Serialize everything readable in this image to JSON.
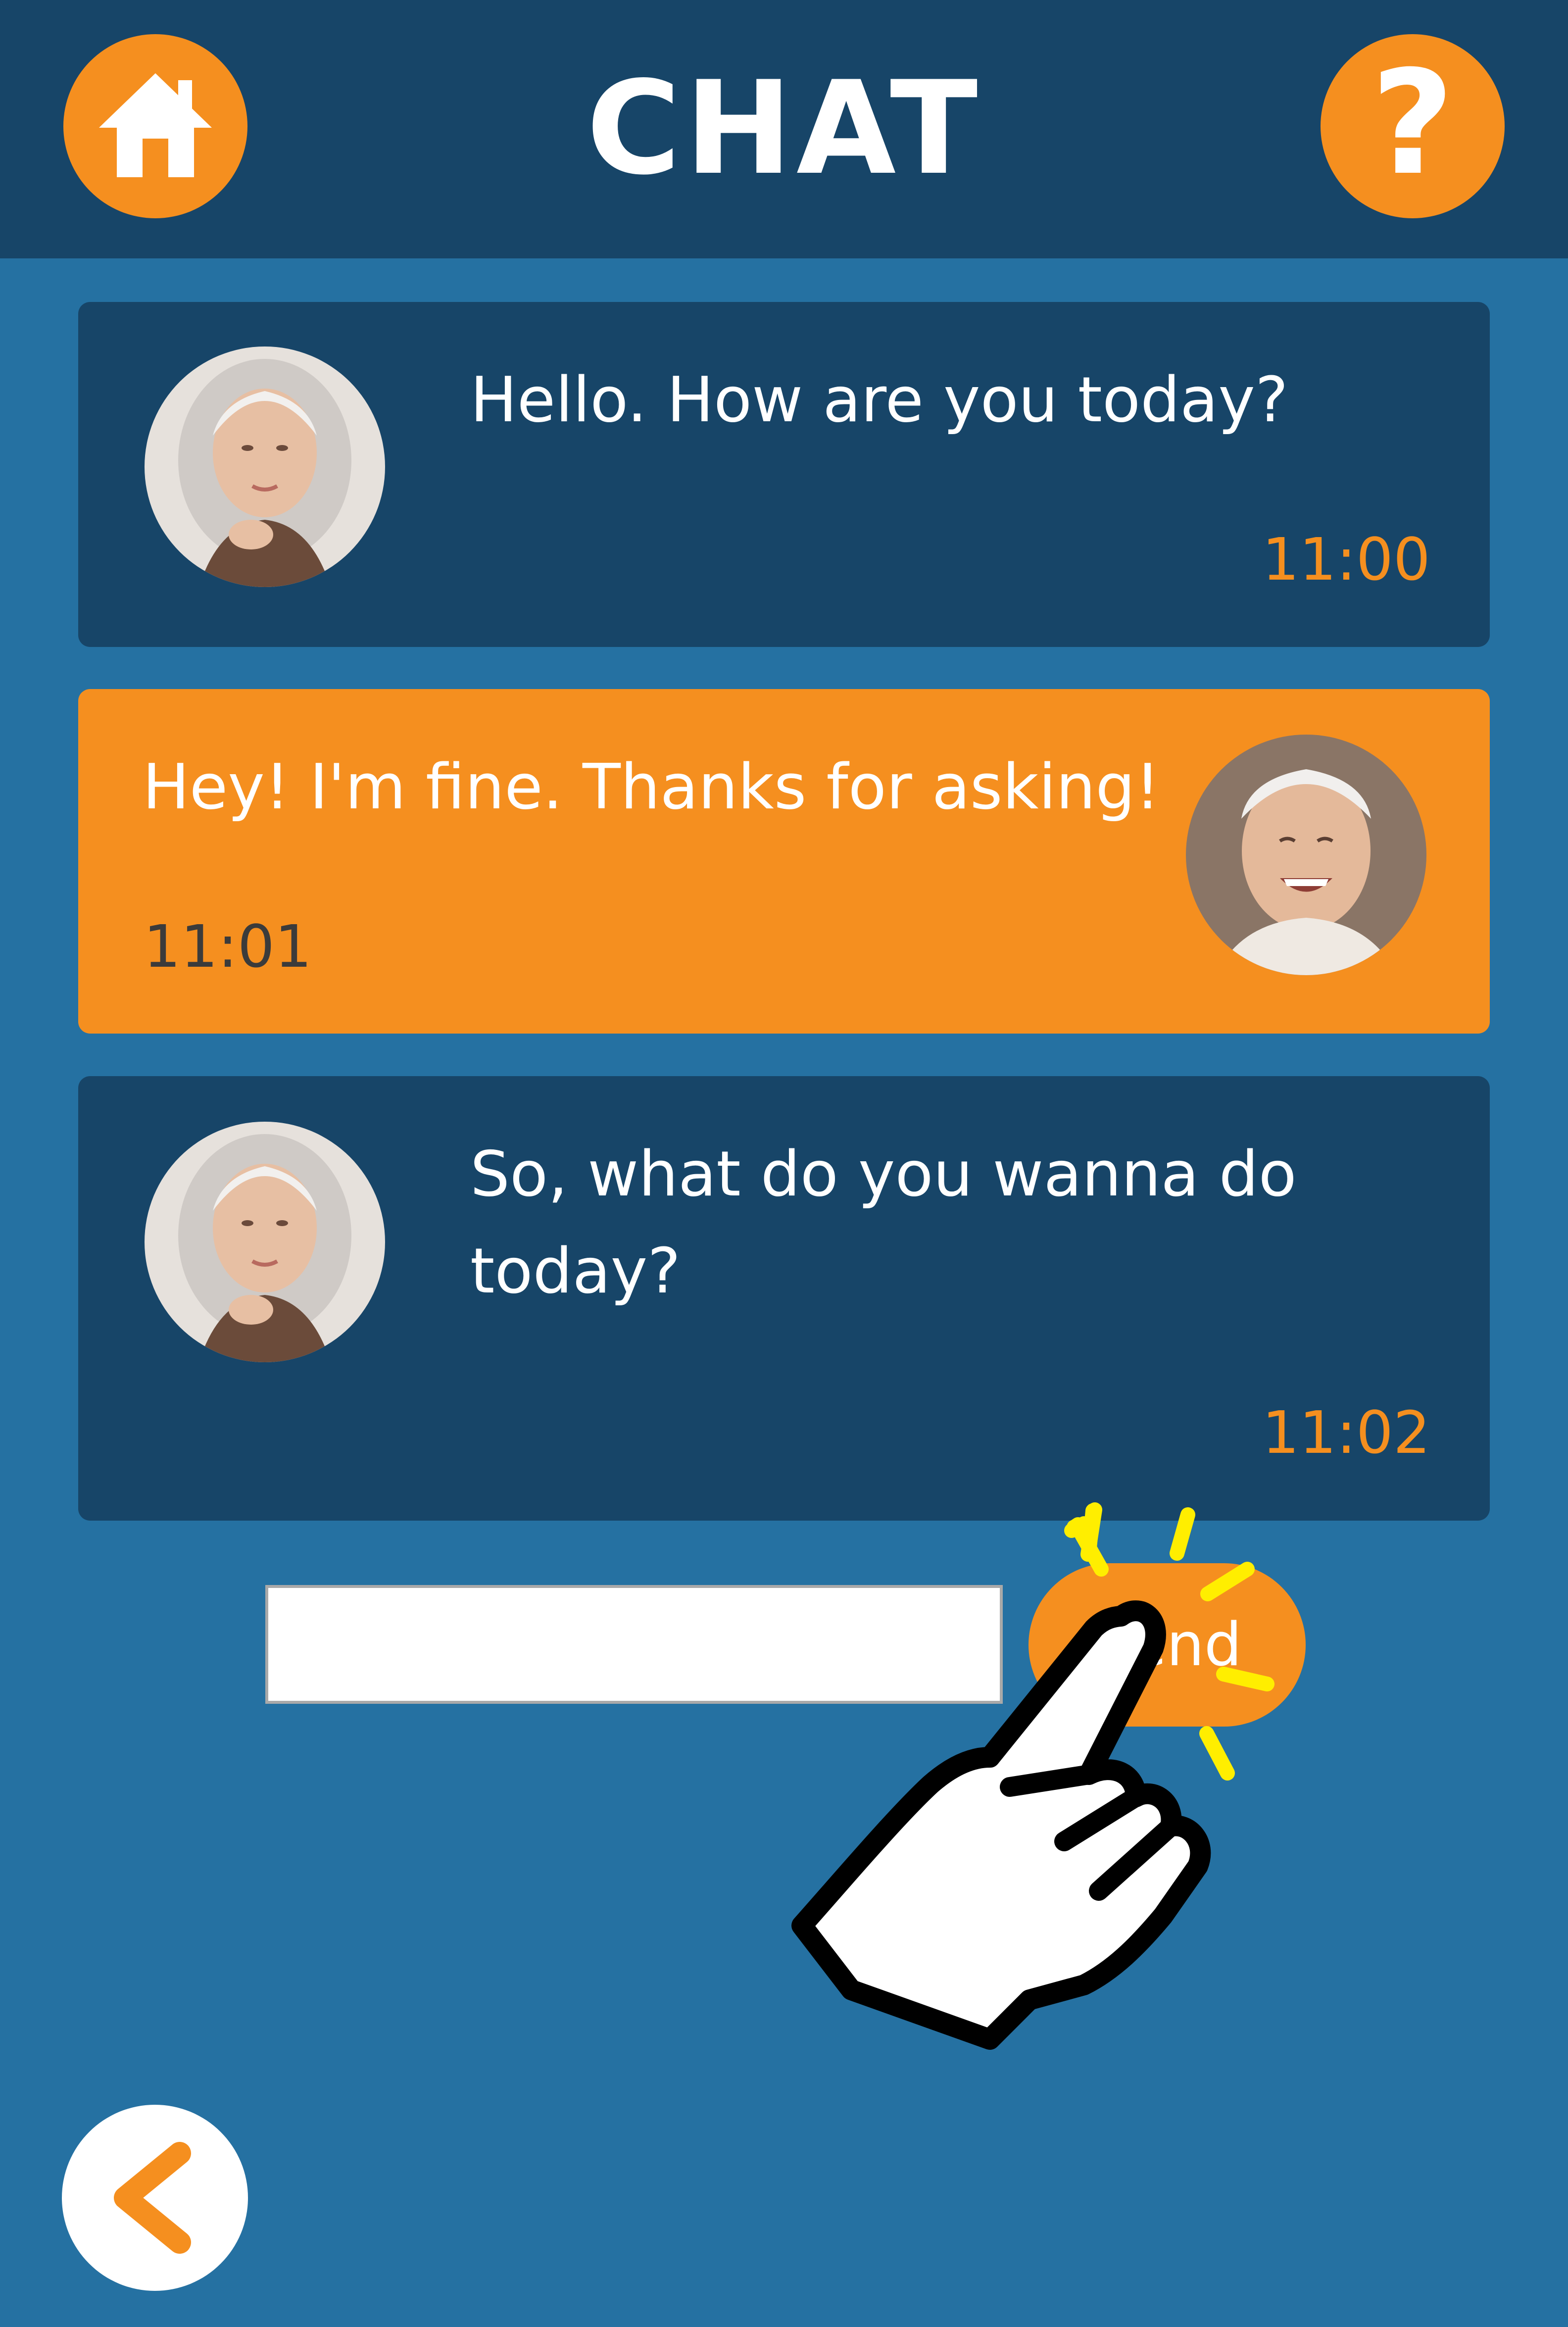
{
  "header": {
    "title": "CHAT",
    "home_icon": "home-icon",
    "help_icon": "question-mark-icon",
    "help_glyph": "?"
  },
  "messages": [
    {
      "sender": "received",
      "text": "Hello. How are you today?",
      "time": "11:00",
      "avatar": "elderly-woman-avatar"
    },
    {
      "sender": "sent",
      "text": "Hey! I'm fine. Thanks for asking!",
      "time": "11:01",
      "avatar": "elderly-man-avatar"
    },
    {
      "sender": "received",
      "text": "So, what do you wanna do today?",
      "time": "11:02",
      "avatar": "elderly-woman-avatar"
    }
  ],
  "composer": {
    "input_value": "",
    "send_label": "Send"
  },
  "overlay": {
    "pointer_icon": "tap-hand-icon"
  },
  "footer": {
    "back_icon": "chevron-left-icon"
  },
  "colors": {
    "background": "#2571a2",
    "header": "#174568",
    "received_bubble": "#174568",
    "sent_bubble": "#f58f1f",
    "accent": "#f58f1f",
    "sparkle": "#ffee00"
  }
}
